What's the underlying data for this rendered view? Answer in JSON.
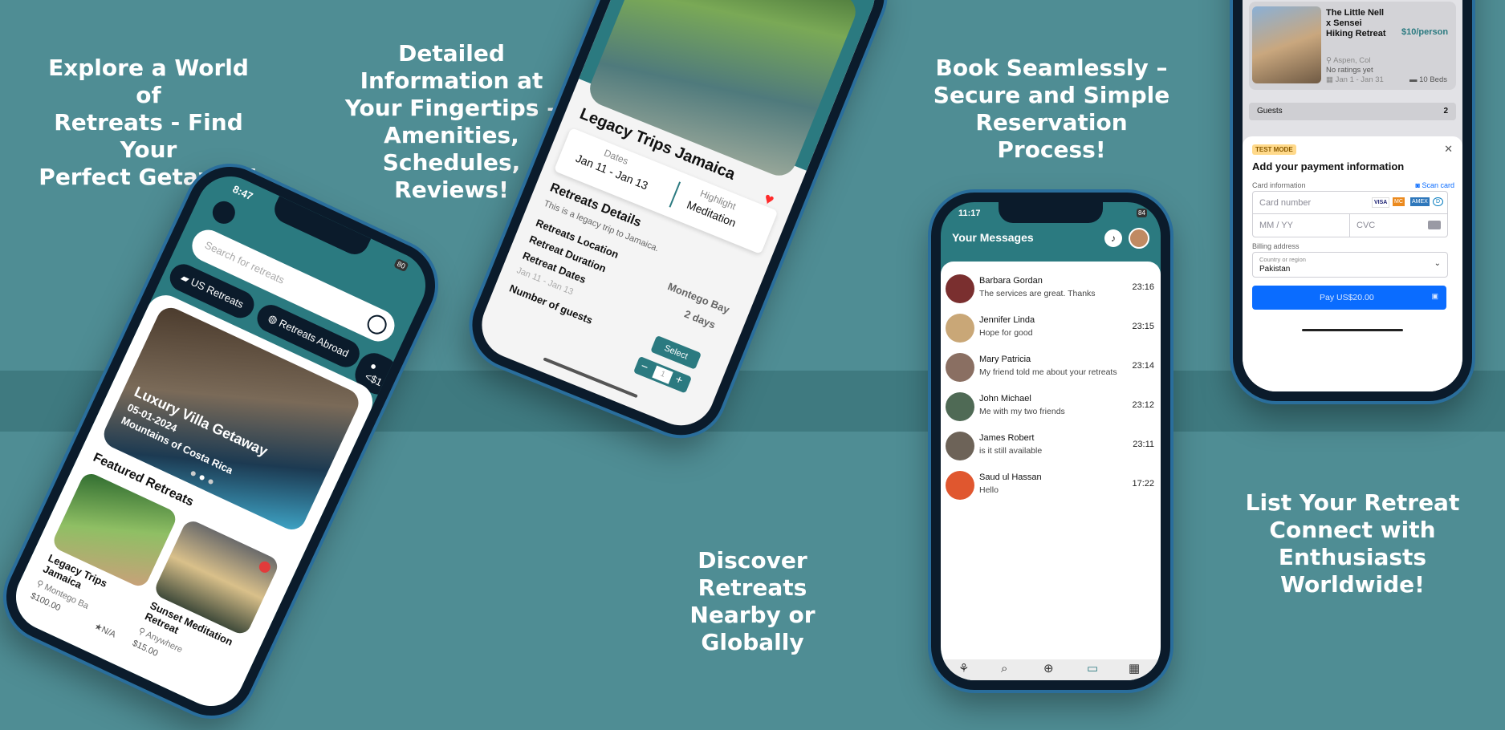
{
  "captions": {
    "c1": [
      "Explore a World of",
      "Retreats - Find Your",
      "Perfect Getaway!"
    ],
    "c2": [
      "Detailed Information at",
      "Your Fingertips –",
      "Amenities, Schedules,",
      "Reviews!"
    ],
    "c3": [
      "Book Seamlessly –",
      "Secure and Simple",
      "Reservation Process!"
    ],
    "c4": [
      "Discover Retreats",
      "Nearby or Globally"
    ],
    "c5": [
      "List Your Retreat",
      "Connect with",
      "Enthusiasts Worldwide!"
    ]
  },
  "phone_home": {
    "time": "8:47",
    "search_placeholder": "Search for retreats",
    "battery": "80",
    "filters": [
      "US Retreats",
      "Retreats Abroad",
      "<$1"
    ],
    "hero": {
      "title": "Luxury Villa Getaway",
      "date": "05-01-2024",
      "location": "Mountains of Costa Rica"
    },
    "section_title": "Featured Retreats",
    "cards": [
      {
        "title": "Legacy Trips Jamaica",
        "location": "Montego Ba",
        "price": "$100.00",
        "rating": "N/A"
      },
      {
        "title": "Sunset Meditation Retreat",
        "location": "Anywhere",
        "price": "$15.00"
      }
    ]
  },
  "phone_detail": {
    "title": "Legacy Trips Jamaica",
    "dates_label": "Dates",
    "dates_value": "Jan 11 - Jan 13",
    "highlight_label": "Highlight",
    "highlight_value": "Meditation",
    "details_title": "Retreats Details",
    "description": "This is a legacy trip to Jamaica.",
    "location_label": "Retreats Location",
    "location_value": "Montego Bay",
    "duration_label": "Retreat Duration",
    "duration_value": "2 days",
    "dates_row_label": "Retreat Dates",
    "dates_row_value": "Jan 11 - Jan 13",
    "guests_label": "Number of guests",
    "select_label": "Select",
    "qty": "1",
    "minus": "−",
    "plus": "+"
  },
  "phone_messages": {
    "time": "11:17",
    "battery": "84",
    "title": "Your Messages",
    "messages": [
      {
        "name": "Barbara Gordan",
        "text": "The services are great. Thanks",
        "time": "23:16",
        "color": "#7a2f2f"
      },
      {
        "name": "Jennifer Linda",
        "text": "Hope for good",
        "time": "23:15",
        "color": "#c9a777"
      },
      {
        "name": "Mary Patricia",
        "text": "My friend told me about your retreats",
        "time": "23:14",
        "color": "#8a6f62"
      },
      {
        "name": "John Michael",
        "text": "Me with my two friends",
        "time": "23:12",
        "color": "#4f6a55"
      },
      {
        "name": "James Robert",
        "text": "is it still available",
        "time": "23:11",
        "color": "#6d6358"
      },
      {
        "name": "Saud ul Hassan",
        "text": "Hello",
        "time": "17:22",
        "color": "#e0572f"
      }
    ]
  },
  "phone_payment": {
    "retreat_title": "The Little Nell x Sensei Hiking Retreat",
    "price": "$10/person",
    "location": "Aspen, Col",
    "ratings": "No ratings yet",
    "dates": "Jan 1 - Jan 31",
    "beds": "10 Beds",
    "guests_label": "Guests",
    "guests_value": "2",
    "test_mode": "TEST MODE",
    "pay_title": "Add your payment information",
    "card_info_label": "Card information",
    "scan_card": "Scan card",
    "card_number_placeholder": "Card number",
    "card_brands": [
      "VISA",
      "MC",
      "AMEX",
      "D"
    ],
    "expiry_placeholder": "MM / YY",
    "cvc_placeholder": "CVC",
    "billing_label": "Billing address",
    "country_label": "Country or region",
    "country_value": "Pakistan",
    "pay_button": "Pay US$20.00"
  },
  "colors": {
    "background": "#4f8d94",
    "teal_app": "#2b7a80",
    "pay_button": "#0a6cff",
    "heart": "#ff2a2a"
  }
}
